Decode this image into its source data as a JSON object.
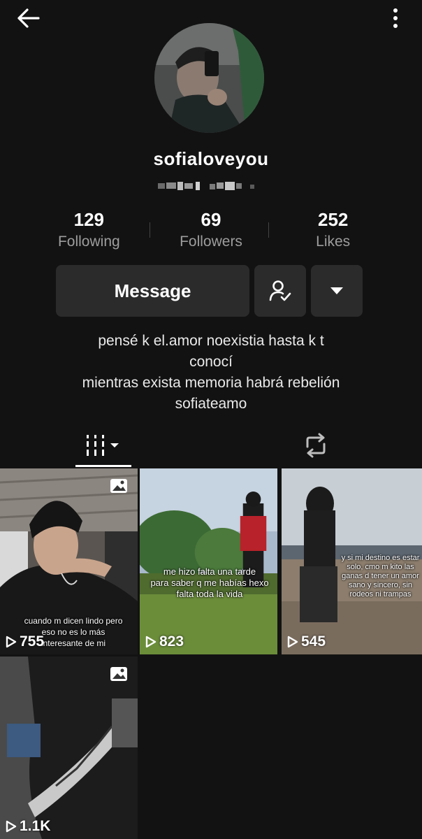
{
  "profile": {
    "username": "sofialoveyou"
  },
  "stats": [
    {
      "count": "129",
      "label": "Following"
    },
    {
      "count": "69",
      "label": "Followers"
    },
    {
      "count": "252",
      "label": "Likes"
    }
  ],
  "actions": {
    "message_label": "Message"
  },
  "bio": {
    "line1": "pensé k el.amor noexistia hasta k t",
    "line2": "conocí",
    "line3": "mientras exista memoria habrá rebelión",
    "line4": "sofiateamo"
  },
  "videos": [
    {
      "views": "755",
      "caption": "cuando m dicen lindo pero\neso no es lo más\ninteresante de mi",
      "is_photo": true
    },
    {
      "views": "823",
      "caption": "me hizo falta una tarde\npara saber q me habías hexo\nfalta toda la vida",
      "is_photo": false
    },
    {
      "views": "545",
      "caption": "y si mi destino es estar\nsolo, cmo m kito las\nganas d tener un amor\nsano y sincero, sin\nrodeos ni trampas",
      "is_photo": false
    },
    {
      "views": "1.1K",
      "caption": "",
      "is_photo": true
    }
  ],
  "colors": {
    "background": "#121212",
    "button_bg": "#2b2b2b",
    "secondary_text": "#9d9d9d"
  }
}
